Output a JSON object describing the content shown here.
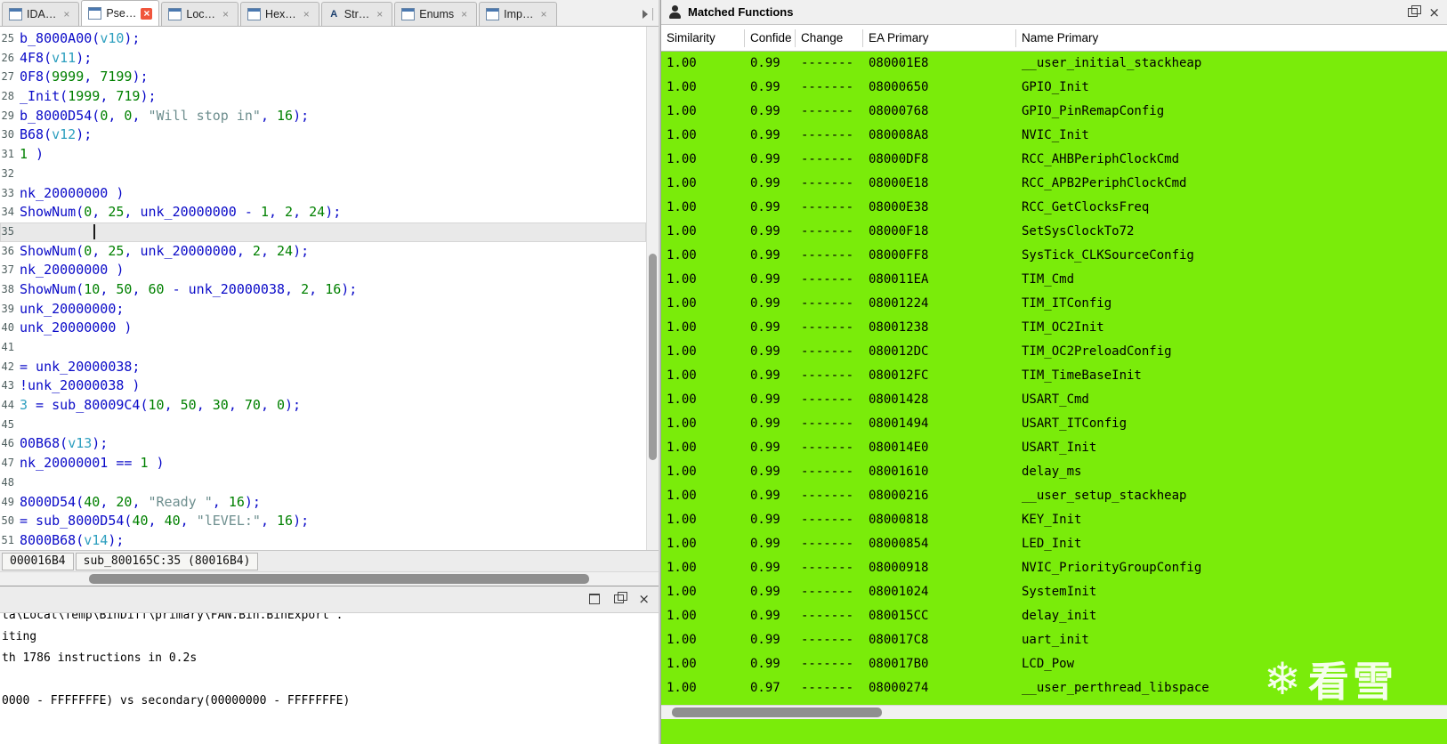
{
  "tabs": [
    {
      "label": "IDA…",
      "icon": "ida-view-icon"
    },
    {
      "label": "Pse…",
      "icon": "pseudocode-icon",
      "active": true
    },
    {
      "label": "Loc…",
      "icon": "local-types-icon"
    },
    {
      "label": "Hex…",
      "icon": "hex-view-icon"
    },
    {
      "label": "Str…",
      "icon": "strings-icon"
    },
    {
      "label": "Enums",
      "icon": "enums-icon"
    },
    {
      "label": "Imp…",
      "icon": "imports-icon"
    }
  ],
  "pseudocode": {
    "lines": [
      {
        "n": "25",
        "tokens": [
          [
            "c",
            "b_8000A00("
          ],
          [
            "v",
            "v10"
          ],
          [
            "c",
            ");"
          ]
        ]
      },
      {
        "n": "26",
        "tokens": [
          [
            "c",
            "4F8("
          ],
          [
            "v",
            "v11"
          ],
          [
            "c",
            ");"
          ]
        ]
      },
      {
        "n": "27",
        "tokens": [
          [
            "c",
            "0F8("
          ],
          [
            "n",
            "9999"
          ],
          [
            "c",
            ", "
          ],
          [
            "n",
            "7199"
          ],
          [
            "c",
            ");"
          ]
        ]
      },
      {
        "n": "28",
        "tokens": [
          [
            "c",
            "_Init("
          ],
          [
            "n",
            "1999"
          ],
          [
            "c",
            ", "
          ],
          [
            "n",
            "719"
          ],
          [
            "c",
            ");"
          ]
        ]
      },
      {
        "n": "29",
        "tokens": [
          [
            "c",
            "b_8000D54("
          ],
          [
            "n",
            "0"
          ],
          [
            "c",
            ", "
          ],
          [
            "n",
            "0"
          ],
          [
            "c",
            ", "
          ],
          [
            "s",
            "\"Will stop in\""
          ],
          [
            "c",
            ", "
          ],
          [
            "n",
            "16"
          ],
          [
            "c",
            ");"
          ]
        ]
      },
      {
        "n": "30",
        "tokens": [
          [
            "c",
            "B68("
          ],
          [
            "v",
            "v12"
          ],
          [
            "c",
            ");"
          ]
        ]
      },
      {
        "n": "31",
        "tokens": [
          [
            "n",
            "1"
          ],
          [
            "c",
            " )"
          ]
        ]
      },
      {
        "n": "32",
        "tokens": []
      },
      {
        "n": "33",
        "tokens": [
          [
            "c",
            "nk_20000000 )"
          ]
        ]
      },
      {
        "n": "34",
        "tokens": [
          [
            "c",
            "ShowNum("
          ],
          [
            "n",
            "0"
          ],
          [
            "c",
            ", "
          ],
          [
            "n",
            "25"
          ],
          [
            "c",
            ", unk_20000000 - "
          ],
          [
            "n",
            "1"
          ],
          [
            "c",
            ", "
          ],
          [
            "n",
            "2"
          ],
          [
            "c",
            ", "
          ],
          [
            "n",
            "24"
          ],
          [
            "c",
            ");"
          ]
        ]
      },
      {
        "n": "35",
        "tokens": [],
        "cursor": true
      },
      {
        "n": "36",
        "tokens": [
          [
            "c",
            "ShowNum("
          ],
          [
            "n",
            "0"
          ],
          [
            "c",
            ", "
          ],
          [
            "n",
            "25"
          ],
          [
            "c",
            ", unk_20000000, "
          ],
          [
            "n",
            "2"
          ],
          [
            "c",
            ", "
          ],
          [
            "n",
            "24"
          ],
          [
            "c",
            ");"
          ]
        ]
      },
      {
        "n": "37",
        "tokens": [
          [
            "c",
            "nk_20000000 )"
          ]
        ]
      },
      {
        "n": "38",
        "tokens": [
          [
            "c",
            "ShowNum("
          ],
          [
            "n",
            "10"
          ],
          [
            "c",
            ", "
          ],
          [
            "n",
            "50"
          ],
          [
            "c",
            ", "
          ],
          [
            "n",
            "60"
          ],
          [
            "c",
            " - unk_20000038, "
          ],
          [
            "n",
            "2"
          ],
          [
            "c",
            ", "
          ],
          [
            "n",
            "16"
          ],
          [
            "c",
            ");"
          ]
        ]
      },
      {
        "n": "39",
        "tokens": [
          [
            "c",
            "unk_20000000;"
          ]
        ]
      },
      {
        "n": "40",
        "tokens": [
          [
            "c",
            "unk_20000000 )"
          ]
        ]
      },
      {
        "n": "41",
        "tokens": []
      },
      {
        "n": "42",
        "tokens": [
          [
            "c",
            "= unk_20000038;"
          ]
        ]
      },
      {
        "n": "43",
        "tokens": [
          [
            "c",
            "!unk_20000038 )"
          ]
        ]
      },
      {
        "n": "44",
        "tokens": [
          [
            "v",
            "3"
          ],
          [
            "c",
            " = sub_80009C4("
          ],
          [
            "n",
            "10"
          ],
          [
            "c",
            ", "
          ],
          [
            "n",
            "50"
          ],
          [
            "c",
            ", "
          ],
          [
            "n",
            "30"
          ],
          [
            "c",
            ", "
          ],
          [
            "n",
            "70"
          ],
          [
            "c",
            ", "
          ],
          [
            "n",
            "0"
          ],
          [
            "c",
            ");"
          ]
        ]
      },
      {
        "n": "45",
        "tokens": []
      },
      {
        "n": "46",
        "tokens": [
          [
            "c",
            "00B68("
          ],
          [
            "v",
            "v13"
          ],
          [
            "c",
            ");"
          ]
        ]
      },
      {
        "n": "47",
        "tokens": [
          [
            "c",
            "nk_20000001 == "
          ],
          [
            "n",
            "1"
          ],
          [
            "c",
            " )"
          ]
        ]
      },
      {
        "n": "48",
        "tokens": []
      },
      {
        "n": "49",
        "tokens": [
          [
            "c",
            "8000D54("
          ],
          [
            "n",
            "40"
          ],
          [
            "c",
            ", "
          ],
          [
            "n",
            "20"
          ],
          [
            "c",
            ", "
          ],
          [
            "s",
            "\"Ready \""
          ],
          [
            "c",
            ", "
          ],
          [
            "n",
            "16"
          ],
          [
            "c",
            ");"
          ]
        ]
      },
      {
        "n": "50",
        "tokens": [
          [
            "c",
            "= sub_8000D54("
          ],
          [
            "n",
            "40"
          ],
          [
            "c",
            ", "
          ],
          [
            "n",
            "40"
          ],
          [
            "c",
            ", "
          ],
          [
            "s",
            "\"lEVEL:\""
          ],
          [
            "c",
            ", "
          ],
          [
            "n",
            "16"
          ],
          [
            "c",
            ");"
          ]
        ]
      },
      {
        "n": "51",
        "tokens": [
          [
            "c",
            "8000B68("
          ],
          [
            "v",
            "v14"
          ],
          [
            "c",
            ");"
          ]
        ]
      }
    ],
    "status": {
      "address": "000016B4",
      "position": "sub_800165C:35 (80016B4)"
    }
  },
  "output": {
    "clipped_line": "ta\\Local\\Temp\\BinDiff\\primary\\FAN.Bin.BinExport'.",
    "lines": [
      "iting",
      "th 1786 instructions in 0.2s",
      "",
      "0000 - FFFFFFFE) vs secondary(00000000 - FFFFFFFE)"
    ]
  },
  "matched_functions": {
    "title": "Matched Functions",
    "columns": [
      "Similarity",
      "Confide",
      "Change",
      "EA Primary",
      "Name Primary"
    ],
    "row_color": "#7aec0a",
    "rows": [
      [
        "1.00",
        "0.99",
        "-------",
        "080001E8",
        "__user_initial_stackheap"
      ],
      [
        "1.00",
        "0.99",
        "-------",
        "08000650",
        "GPIO_Init"
      ],
      [
        "1.00",
        "0.99",
        "-------",
        "08000768",
        "GPIO_PinRemapConfig"
      ],
      [
        "1.00",
        "0.99",
        "-------",
        "080008A8",
        "NVIC_Init"
      ],
      [
        "1.00",
        "0.99",
        "-------",
        "08000DF8",
        "RCC_AHBPeriphClockCmd"
      ],
      [
        "1.00",
        "0.99",
        "-------",
        "08000E18",
        "RCC_APB2PeriphClockCmd"
      ],
      [
        "1.00",
        "0.99",
        "-------",
        "08000E38",
        "RCC_GetClocksFreq"
      ],
      [
        "1.00",
        "0.99",
        "-------",
        "08000F18",
        "SetSysClockTo72"
      ],
      [
        "1.00",
        "0.99",
        "-------",
        "08000FF8",
        "SysTick_CLKSourceConfig"
      ],
      [
        "1.00",
        "0.99",
        "-------",
        "080011EA",
        "TIM_Cmd"
      ],
      [
        "1.00",
        "0.99",
        "-------",
        "08001224",
        "TIM_ITConfig"
      ],
      [
        "1.00",
        "0.99",
        "-------",
        "08001238",
        "TIM_OC2Init"
      ],
      [
        "1.00",
        "0.99",
        "-------",
        "080012DC",
        "TIM_OC2PreloadConfig"
      ],
      [
        "1.00",
        "0.99",
        "-------",
        "080012FC",
        "TIM_TimeBaseInit"
      ],
      [
        "1.00",
        "0.99",
        "-------",
        "08001428",
        "USART_Cmd"
      ],
      [
        "1.00",
        "0.99",
        "-------",
        "08001494",
        "USART_ITConfig"
      ],
      [
        "1.00",
        "0.99",
        "-------",
        "080014E0",
        "USART_Init"
      ],
      [
        "1.00",
        "0.99",
        "-------",
        "08001610",
        "delay_ms"
      ],
      [
        "1.00",
        "0.99",
        "-------",
        "08000216",
        "__user_setup_stackheap"
      ],
      [
        "1.00",
        "0.99",
        "-------",
        "08000818",
        "KEY_Init"
      ],
      [
        "1.00",
        "0.99",
        "-------",
        "08000854",
        "LED_Init"
      ],
      [
        "1.00",
        "0.99",
        "-------",
        "08000918",
        "NVIC_PriorityGroupConfig"
      ],
      [
        "1.00",
        "0.99",
        "-------",
        "08001024",
        "SystemInit"
      ],
      [
        "1.00",
        "0.99",
        "-------",
        "080015CC",
        "delay_init"
      ],
      [
        "1.00",
        "0.99",
        "-------",
        "080017C8",
        "uart_init"
      ],
      [
        "1.00",
        "0.99",
        "-------",
        "080017B0",
        "LCD_Pow"
      ],
      [
        "1.00",
        "0.97",
        "-------",
        "08000274",
        "__user_perthread_libspace"
      ]
    ]
  },
  "watermark": {
    "icon_char": "❄",
    "text": "看雪"
  },
  "colors": {
    "code_blue": "#0a0ac8",
    "number_green": "#008000",
    "string_gray": "#6d8e8e",
    "variable_cyan": "#2d9fbf"
  }
}
